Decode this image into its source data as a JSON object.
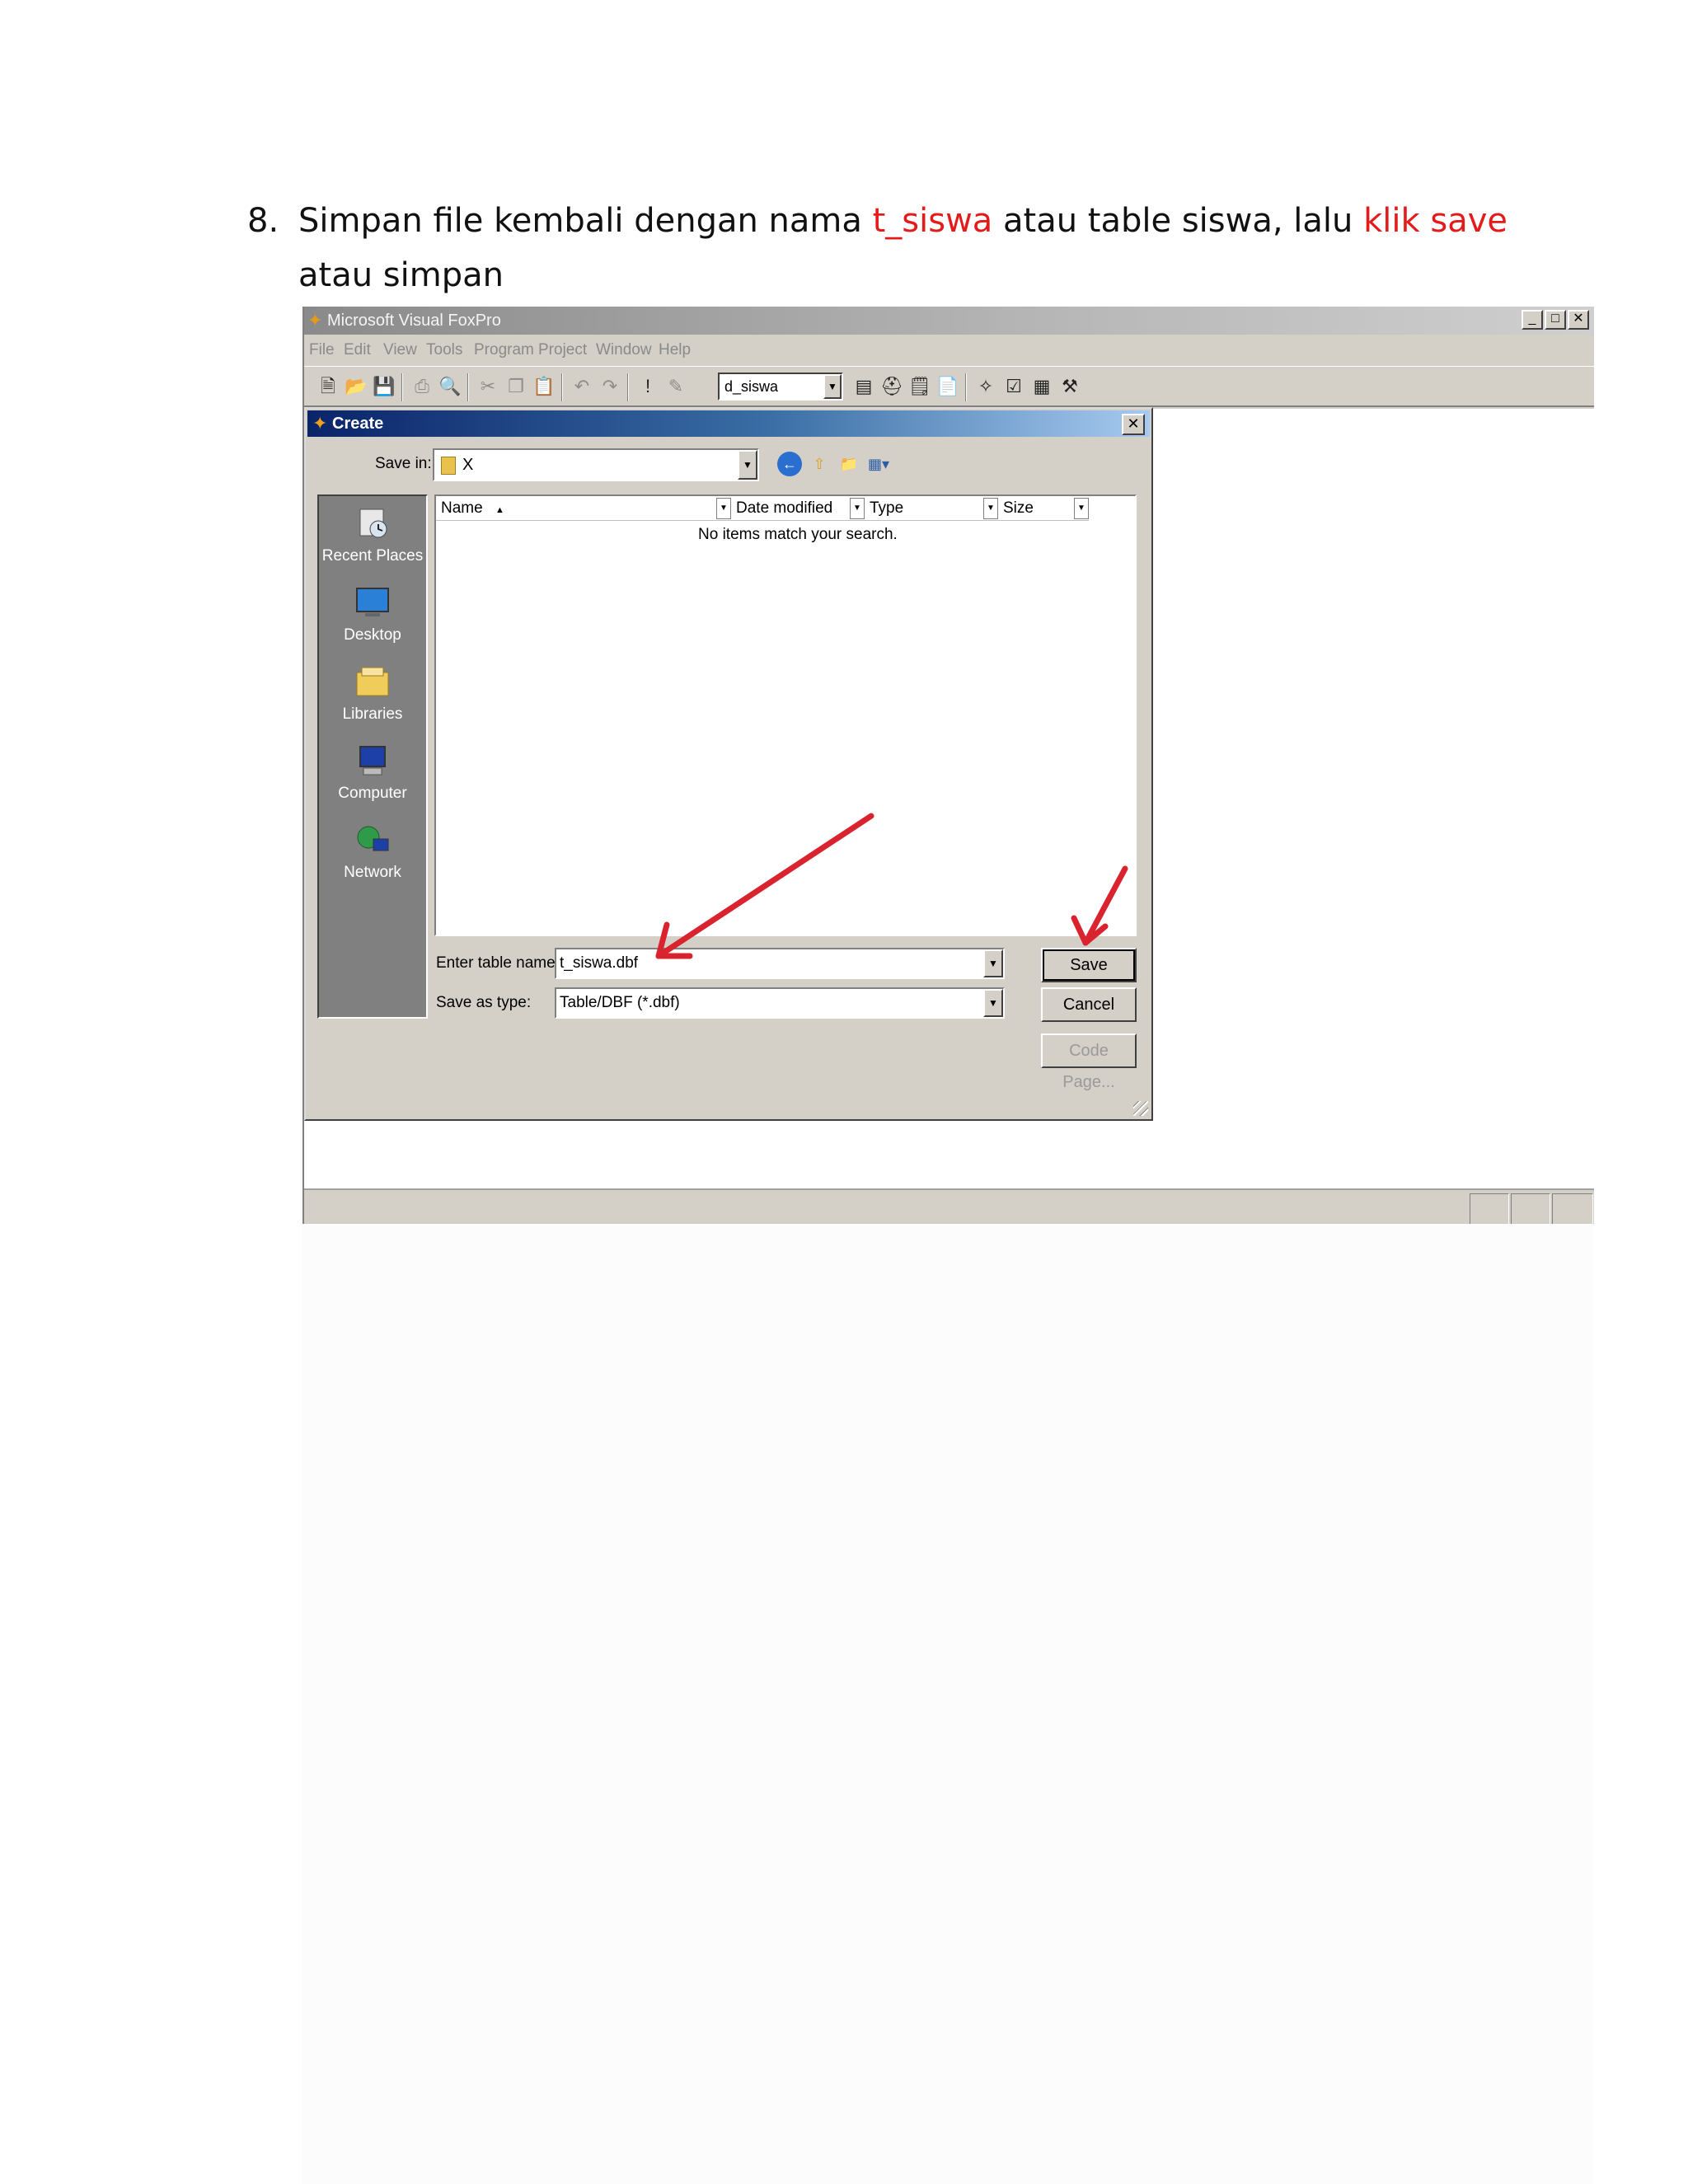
{
  "instruction": {
    "number": "8.",
    "line1_prefix": "Simpan file kembali dengan nama ",
    "line1_highlight1": "t_siswa",
    "line1_middle": " atau table siswa, lalu ",
    "line1_highlight2": "klik save",
    "line2": "atau simpan",
    "highlight_color": "#e31b1b"
  },
  "app": {
    "title": "Microsoft Visual FoxPro",
    "window_controls": [
      "_",
      "□",
      "✕"
    ],
    "menu": [
      "File",
      "Edit",
      "View",
      "Tools",
      "Program",
      "Project",
      "Window",
      "Help"
    ],
    "toolbar_combo_value": "d_siswa"
  },
  "dialog": {
    "title": "Create",
    "save_in_label": "Save in:",
    "save_in_value": "X",
    "places": [
      "Recent Places",
      "Desktop",
      "Libraries",
      "Computer",
      "Network"
    ],
    "columns": [
      "Name",
      "Date modified",
      "Type",
      "Size"
    ],
    "empty_message": "No items match your search.",
    "table_name_label": "Enter table name:",
    "table_name_value": "t_siswa.dbf",
    "save_type_label": "Save as type:",
    "save_type_value": "Table/DBF (*.dbf)",
    "buttons": {
      "save": "Save",
      "cancel": "Cancel",
      "code_page": "Code Page..."
    }
  },
  "annotation_color": "#d9232e"
}
